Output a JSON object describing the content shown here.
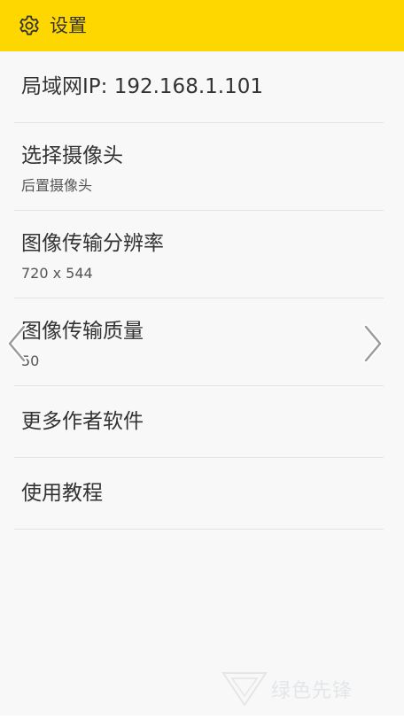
{
  "header": {
    "title": "设置",
    "icon": "gear-icon",
    "background": "#ffd700"
  },
  "settings": {
    "ip": {
      "label": "局域网IP: 192.168.1.101"
    },
    "camera": {
      "label": "选择摄像头",
      "value": "后置摄像头"
    },
    "resolution": {
      "label": "图像传输分辨率",
      "value": "720 x 544"
    },
    "quality": {
      "label": "图像传输质量",
      "value": "50"
    },
    "more_apps": {
      "label": "更多作者软件"
    },
    "tutorial": {
      "label": "使用教程"
    }
  },
  "navigation": {
    "prev_icon": "chevron-left-icon",
    "next_icon": "chevron-right-icon"
  },
  "watermark": {
    "text": "绿色先锋"
  }
}
